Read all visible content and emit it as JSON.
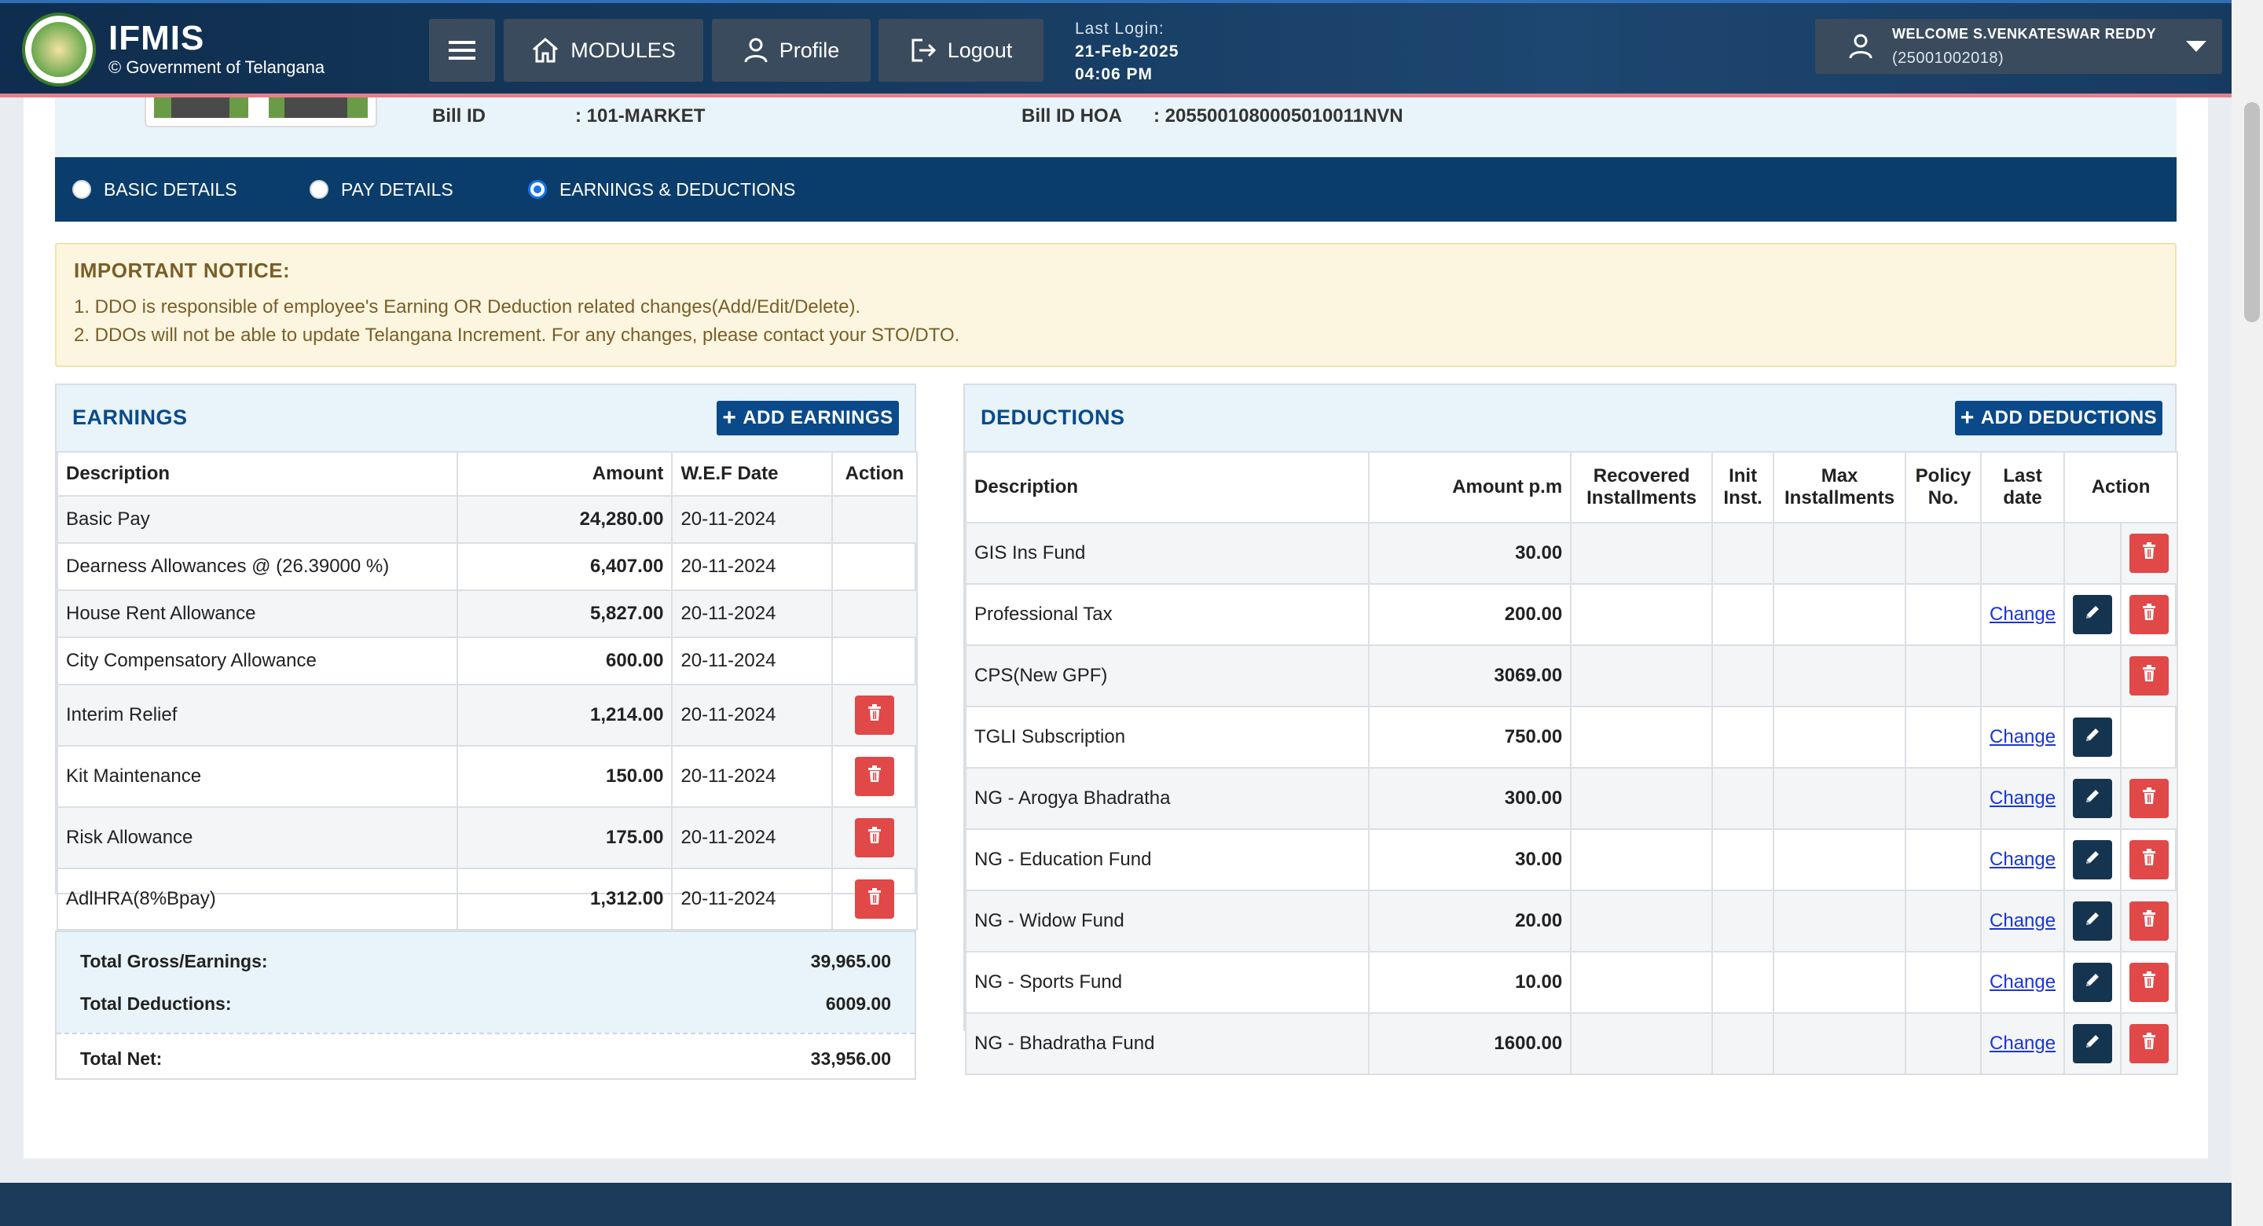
{
  "header": {
    "brand_title": "IFMIS",
    "brand_subtitle": "© Government of Telangana",
    "modules_label": "MODULES",
    "profile_label": "Profile",
    "logout_label": "Logout",
    "last_login_label": "Last Login:",
    "last_login_date": "21-Feb-2025",
    "last_login_time": "04:06 PM",
    "welcome_text": "WELCOME S.VENKATESWAR REDDY",
    "user_id": "(25001002018)"
  },
  "bill": {
    "bill_id_label": "Bill ID",
    "bill_id_value": ": 101-MARKET",
    "bill_hoa_label": "Bill ID HOA",
    "bill_hoa_value": ": 2055001080005010011NVN"
  },
  "tabs": [
    {
      "label": "BASIC DETAILS",
      "selected": false
    },
    {
      "label": "PAY DETAILS",
      "selected": false
    },
    {
      "label": "EARNINGS & DEDUCTIONS",
      "selected": true
    }
  ],
  "notice": {
    "title": "IMPORTANT NOTICE:",
    "line1": "1. DDO is responsible of employee's Earning OR Deduction related changes(Add/Edit/Delete).",
    "line2": "2. DDOs will not be able to update Telangana Increment. For any changes, please contact your STO/DTO."
  },
  "earnings": {
    "title": "EARNINGS",
    "add_label": "ADD EARNINGS",
    "headers": [
      "Description",
      "Amount",
      "W.E.F Date",
      "Action"
    ],
    "rows": [
      {
        "desc": "Basic Pay",
        "amount": "24,280.00",
        "date": "20-11-2024",
        "delete": false
      },
      {
        "desc": "Dearness Allowances @ (26.39000 %)",
        "amount": "6,407.00",
        "date": "20-11-2024",
        "delete": false
      },
      {
        "desc": "House Rent Allowance",
        "amount": "5,827.00",
        "date": "20-11-2024",
        "delete": false
      },
      {
        "desc": "City Compensatory Allowance",
        "amount": "600.00",
        "date": "20-11-2024",
        "delete": false
      },
      {
        "desc": "Interim Relief",
        "amount": "1,214.00",
        "date": "20-11-2024",
        "delete": true
      },
      {
        "desc": "Kit Maintenance",
        "amount": "150.00",
        "date": "20-11-2024",
        "delete": true
      },
      {
        "desc": "Risk Allowance",
        "amount": "175.00",
        "date": "20-11-2024",
        "delete": true
      },
      {
        "desc": "AdlHRA(8%Bpay)",
        "amount": "1,312.00",
        "date": "20-11-2024",
        "delete": true
      }
    ]
  },
  "totals": {
    "gross_label": "Total Gross/Earnings:",
    "gross_value": "39,965.00",
    "deductions_label": "Total Deductions:",
    "deductions_value": "6009.00",
    "net_label": "Total Net:",
    "net_value": "33,956.00"
  },
  "deductions": {
    "title": "DEDUCTIONS",
    "add_label": "ADD DEDUCTIONS",
    "headers": [
      "Description",
      "Amount p.m",
      "Recovered Installments",
      "Init Inst.",
      "Max Installments",
      "Policy No.",
      "Last date",
      "Action"
    ],
    "change_label": "Change",
    "rows": [
      {
        "desc": "GIS Ins Fund",
        "amount": "30.00",
        "change": false,
        "edit": false,
        "delete": true
      },
      {
        "desc": "Professional Tax",
        "amount": "200.00",
        "change": true,
        "edit": true,
        "delete": true
      },
      {
        "desc": "CPS(New GPF)",
        "amount": "3069.00",
        "change": false,
        "edit": false,
        "delete": true
      },
      {
        "desc": "TGLI Subscription",
        "amount": "750.00",
        "change": true,
        "edit": true,
        "delete": false
      },
      {
        "desc": "NG - Arogya Bhadratha",
        "amount": "300.00",
        "change": true,
        "edit": true,
        "delete": true
      },
      {
        "desc": "NG - Education Fund",
        "amount": "30.00",
        "change": true,
        "edit": true,
        "delete": true
      },
      {
        "desc": "NG - Widow Fund",
        "amount": "20.00",
        "change": true,
        "edit": true,
        "delete": true
      },
      {
        "desc": "NG - Sports Fund",
        "amount": "10.00",
        "change": true,
        "edit": true,
        "delete": true
      },
      {
        "desc": "NG - Bhadratha Fund",
        "amount": "1600.00",
        "change": true,
        "edit": true,
        "delete": true
      }
    ]
  },
  "colors": {
    "navbar": "#173d63",
    "primary": "#0a4a8a",
    "tabbar": "#0a3d6b",
    "danger": "#e14848",
    "edit": "#153450"
  },
  "icons": {
    "menu": "hamburger-icon",
    "modules": "home-icon",
    "profile": "user-icon",
    "logout": "logout-icon",
    "delete": "trash-icon",
    "edit": "pencil-icon"
  }
}
